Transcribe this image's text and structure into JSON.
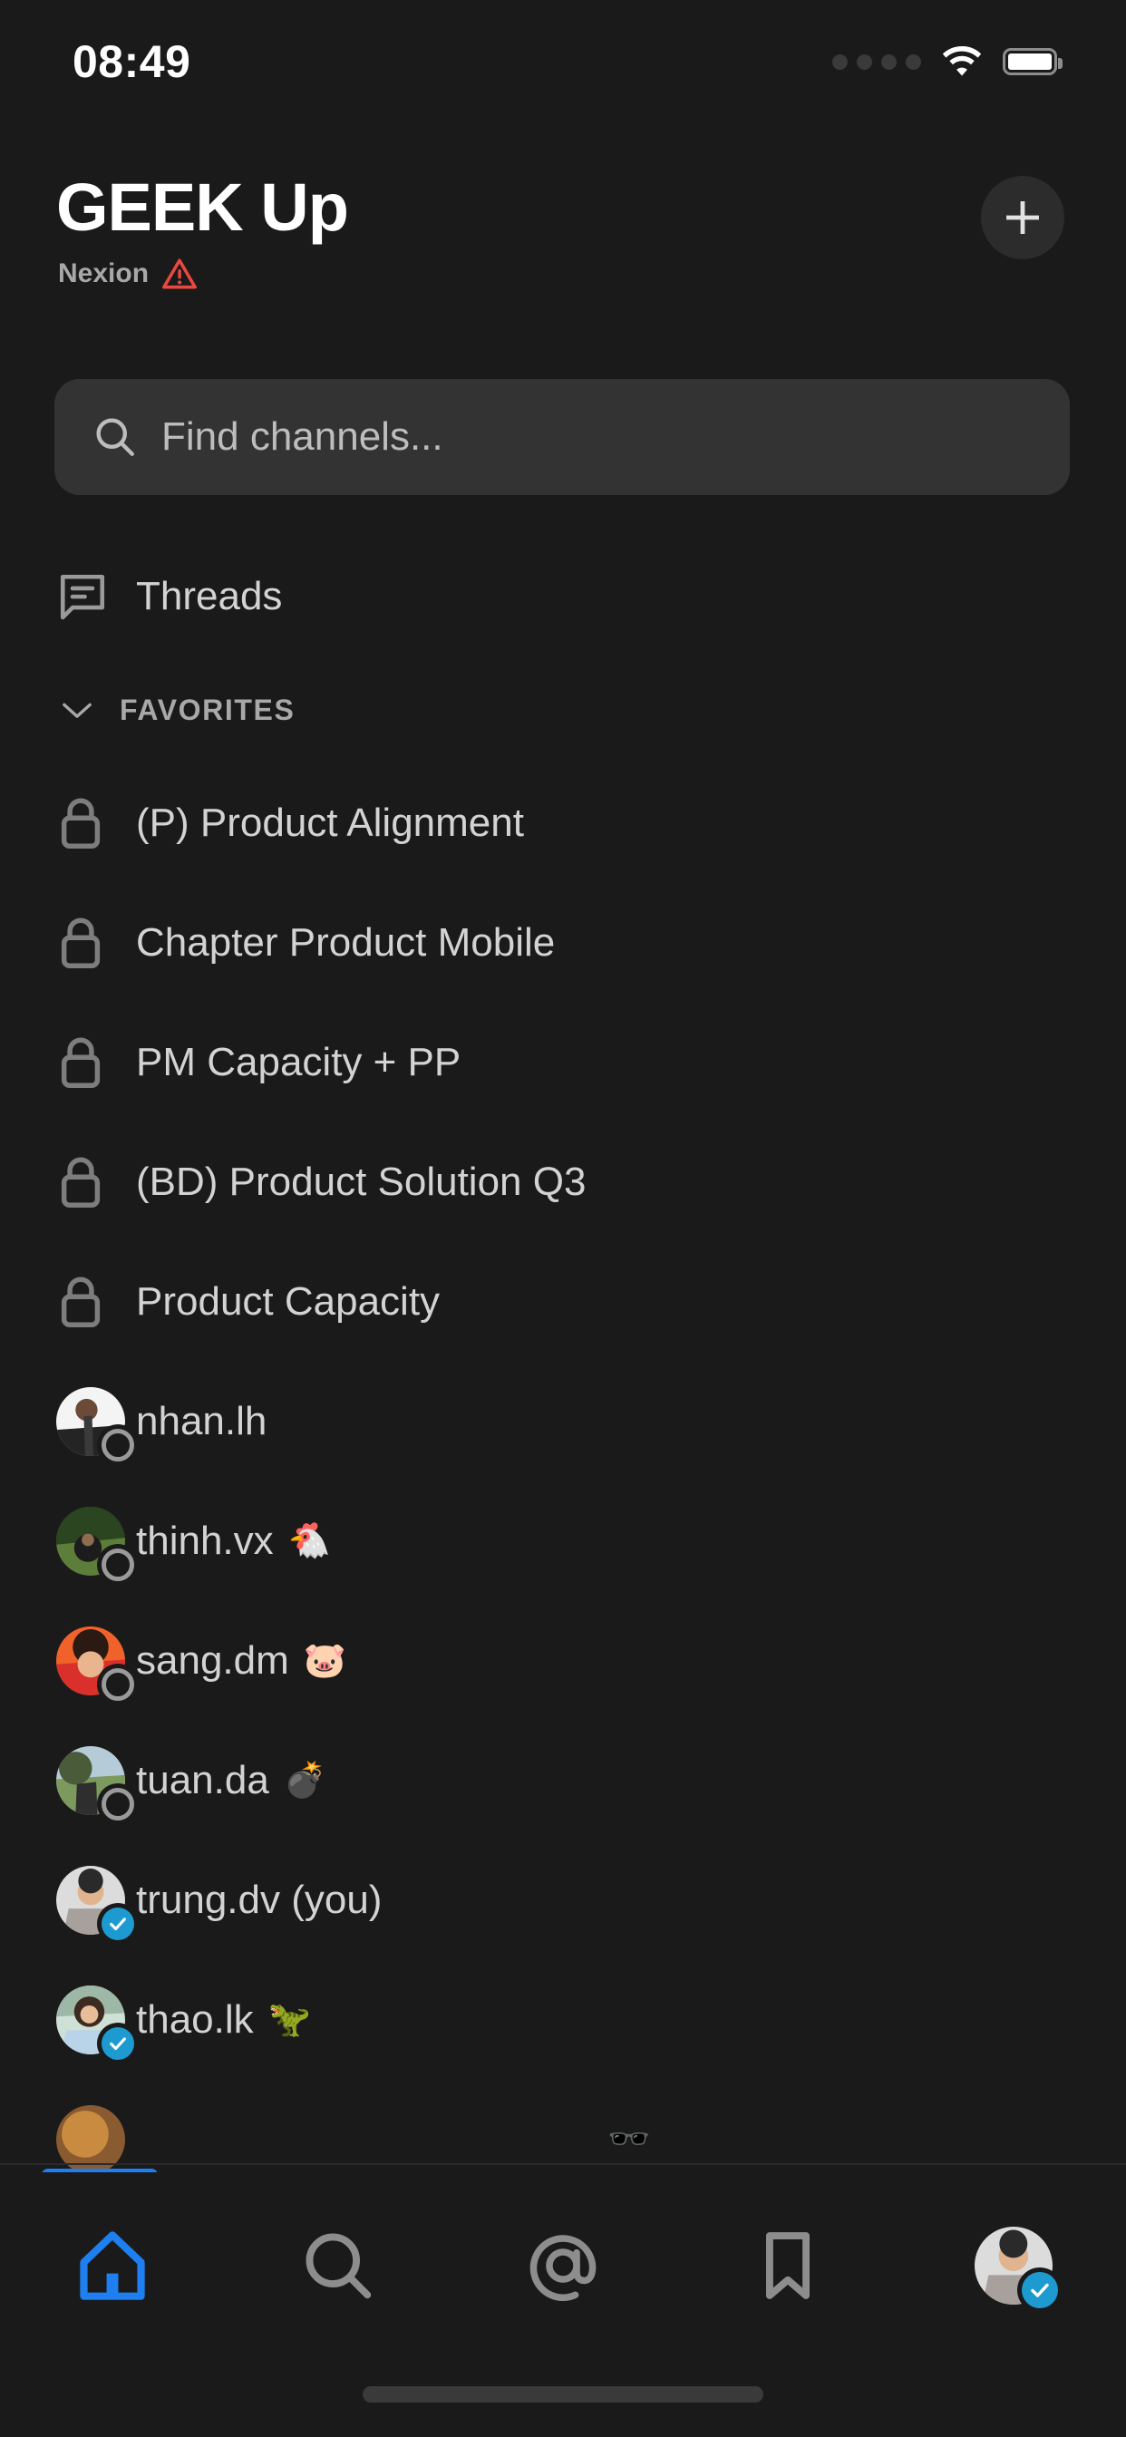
{
  "status_bar": {
    "time": "08:49",
    "signal_icon": "signal-dots-icon",
    "wifi_icon": "wifi-icon",
    "battery_icon": "battery-full-icon"
  },
  "header": {
    "workspace_title": "GEEK Up",
    "workspace_subtitle": "Nexion",
    "warning_icon": "warning-triangle-icon",
    "new_button_icon": "plus-icon"
  },
  "search": {
    "placeholder": "Find channels...",
    "icon": "search-icon"
  },
  "threads": {
    "label": "Threads",
    "icon": "threads-icon"
  },
  "favorites_section": {
    "title": "FAVORITES",
    "chevron_icon": "chevron-down-icon",
    "channels": [
      {
        "name": "(P) Product Alignment",
        "icon": "lock-icon"
      },
      {
        "name": "Chapter Product Mobile",
        "icon": "lock-icon"
      },
      {
        "name": "PM Capacity + PP",
        "icon": "lock-icon"
      },
      {
        "name": "(BD) Product Solution Q3",
        "icon": "lock-icon"
      },
      {
        "name": "Product Capacity",
        "icon": "lock-icon"
      }
    ],
    "direct_messages": [
      {
        "name": "nhan.lh",
        "emoji": "",
        "presence": "away",
        "avatar_colors": [
          "#f1f1f1",
          "#2b2b2b"
        ]
      },
      {
        "name": "thinh.vx",
        "emoji": "🐔",
        "presence": "away",
        "avatar_colors": [
          "#5d7d3a",
          "#26391a"
        ]
      },
      {
        "name": "sang.dm",
        "emoji": "🐷",
        "presence": "away",
        "avatar_colors": [
          "#f05a28",
          "#d42a2a"
        ]
      },
      {
        "name": "tuan.da",
        "emoji": "💣",
        "presence": "away",
        "avatar_colors": [
          "#9fb6c8",
          "#6d8a5a"
        ]
      },
      {
        "name": "trung.dv (you)",
        "emoji": "",
        "presence": "active",
        "avatar_colors": [
          "#d8d8d8",
          "#b8b0aa"
        ]
      },
      {
        "name": "thao.lk",
        "emoji": "🦖",
        "presence": "active",
        "avatar_colors": [
          "#cfe0d6",
          "#8fae98"
        ]
      }
    ]
  },
  "colors": {
    "background": "#1a1a1a",
    "search_field": "#333333",
    "accent_blue": "#1d7ff0",
    "presence_active": "#1d9bd1",
    "warning_red": "#e8483f",
    "text_primary": "#d3d3d3",
    "text_muted": "#a8a8a8"
  },
  "tab_bar": {
    "tabs": [
      {
        "name": "home",
        "icon": "home-icon",
        "active": true
      },
      {
        "name": "search",
        "icon": "search-icon",
        "active": false
      },
      {
        "name": "mentions",
        "icon": "at-mention-icon",
        "active": false
      },
      {
        "name": "saved",
        "icon": "bookmark-icon",
        "active": false
      },
      {
        "name": "you",
        "icon": "avatar-icon",
        "active": false
      }
    ],
    "home_indicator": "home-indicator"
  }
}
